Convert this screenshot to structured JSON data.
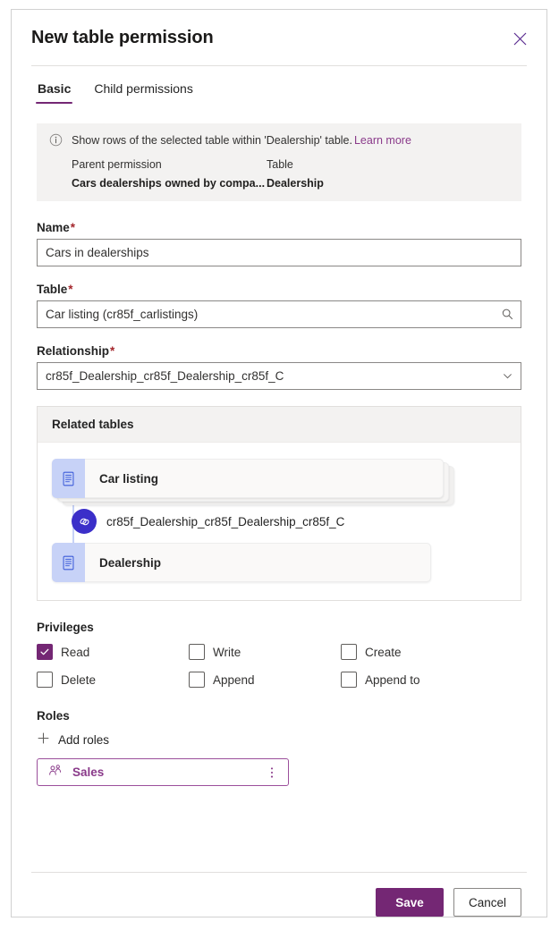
{
  "dialog": {
    "title": "New table permission",
    "close_icon": "close-icon"
  },
  "tabs": [
    {
      "label": "Basic",
      "active": true
    },
    {
      "label": "Child permissions",
      "active": false
    }
  ],
  "info_banner": {
    "icon": "info-circle-icon",
    "message": "Show rows of the selected table within 'Dealership' table.",
    "learn_more": "Learn more",
    "columns": [
      {
        "header": "Parent permission",
        "value": "Cars dealerships owned by compa..."
      },
      {
        "header": "Table",
        "value": "Dealership"
      }
    ]
  },
  "fields": {
    "name": {
      "label": "Name",
      "required": "*",
      "value": "Cars in dealerships",
      "placeholder": ""
    },
    "table": {
      "label": "Table",
      "required": "*",
      "value": "Car listing (cr85f_carlistings)",
      "placeholder": "",
      "icon": "search-icon"
    },
    "relationship": {
      "label": "Relationship",
      "required": "*",
      "value": "cr85f_Dealership_cr85f_Dealership_cr85f_C",
      "icon": "chevron-down-icon"
    }
  },
  "related_tables": {
    "header": "Related tables",
    "source_table": "Car listing",
    "relationship_name": "cr85f_Dealership_cr85f_Dealership_cr85f_C",
    "target_table": "Dealership",
    "table_icon": "table-icon",
    "link_icon": "link-icon"
  },
  "privileges": {
    "label": "Privileges",
    "items": [
      {
        "label": "Read",
        "checked": true
      },
      {
        "label": "Write",
        "checked": false
      },
      {
        "label": "Create",
        "checked": false
      },
      {
        "label": "Delete",
        "checked": false
      },
      {
        "label": "Append",
        "checked": false
      },
      {
        "label": "Append to",
        "checked": false
      }
    ]
  },
  "roles": {
    "label": "Roles",
    "add_label": "Add roles",
    "add_icon": "plus-icon",
    "chips": [
      {
        "name": "Sales",
        "icon": "person-group-icon",
        "more_icon": "more-vertical-icon"
      }
    ]
  },
  "footer": {
    "save_label": "Save",
    "cancel_label": "Cancel"
  },
  "colors": {
    "accent": "#742774",
    "link": "#8a3a8a",
    "required": "#a4262c",
    "banner_bg": "#f3f2f1",
    "node_icon_bg": "#c7d2f7",
    "relationship_badge": "#3b2fc9"
  }
}
